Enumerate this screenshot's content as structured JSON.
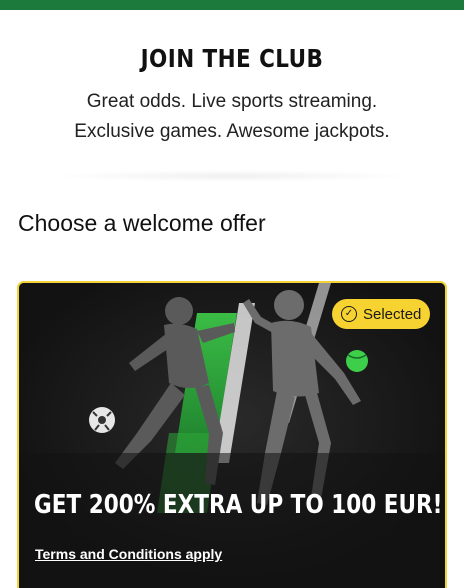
{
  "header": {
    "title": "JOIN THE CLUB",
    "tagline_line1": "Great odds. Live sports streaming.",
    "tagline_line2": "Exclusive games. Awesome jackpots."
  },
  "offers_section": {
    "heading": "Choose a welcome offer"
  },
  "offer_card": {
    "badge_label": "Selected",
    "badge_icon": "check-icon",
    "title": "GET 200% EXTRA UP TO 100 EUR!",
    "terms_link": "Terms and Conditions apply"
  },
  "colors": {
    "brand_green": "#1b7a3c",
    "accent_yellow": "#f6d331",
    "card_background": "#121212",
    "neon_green": "#3ecf4a"
  }
}
